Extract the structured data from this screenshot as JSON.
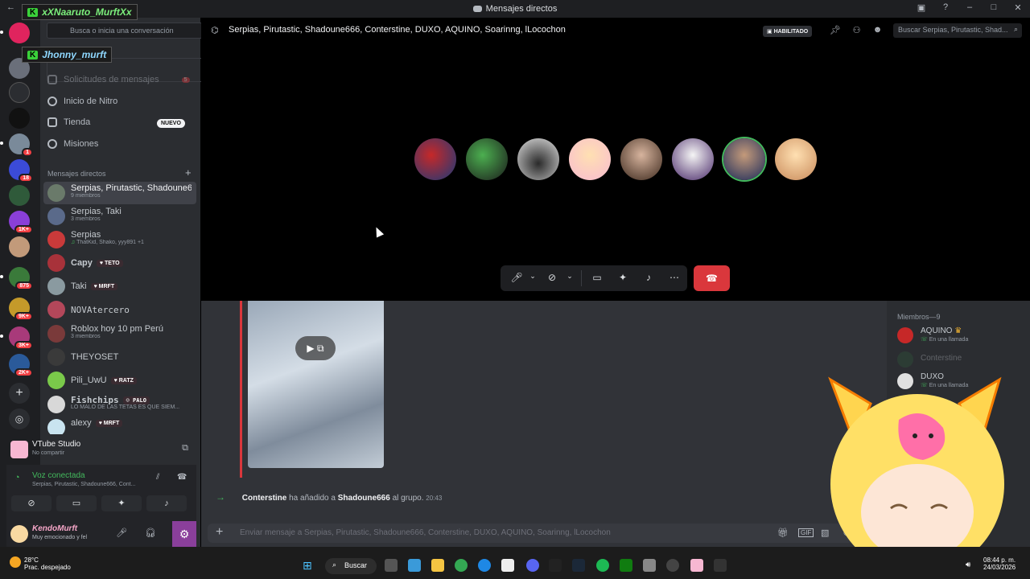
{
  "window": {
    "title": "Mensajes directos"
  },
  "overlays": {
    "name1": "xXNaaruto_MurftXx",
    "name2": "Jhonny_murft",
    "k_label": "K"
  },
  "sidebar": {
    "search_placeholder": "Busca o inicia una conversación",
    "nav": [
      {
        "label": "Solicitudes de mensajes",
        "badge": "5"
      },
      {
        "label": "Inicio de Nitro"
      },
      {
        "label": "Tienda",
        "badge": "NUEVO"
      },
      {
        "label": "Misiones"
      }
    ],
    "dm_header": "Mensajes directos",
    "dms": [
      {
        "name": "Serpias, Pirutastic, Shadoune6...",
        "sub": "9 miembros"
      },
      {
        "name": "Serpias, Taki",
        "sub": "3 miembros"
      },
      {
        "name": "Serpias",
        "sub": "ThatKid, Shako, yyy891 +1"
      },
      {
        "name": "Capy",
        "tag": "TETO"
      },
      {
        "name": "Taki",
        "tag": "MRFT"
      },
      {
        "name": "NOVAtercero"
      },
      {
        "name": "Roblox hoy 10 pm Perú",
        "sub": "3 miembros"
      },
      {
        "name": "THEYOSET"
      },
      {
        "name": "Pili_UwU",
        "tag": "RATZ"
      },
      {
        "name": "Fishchips",
        "tag": "PALO",
        "sub": "LO MALO DE LAS TETAS ES QUE SIEM..."
      },
      {
        "name": "alexy",
        "tag": "MRFT"
      }
    ],
    "server_badges": [
      "1",
      "18",
      "1K+",
      "875",
      "9K+",
      "3K+",
      "2K+"
    ]
  },
  "stream": {
    "app": "VTube Studio",
    "status": "No compartir"
  },
  "voice": {
    "status": "Voz conectada",
    "channel": "Serpias, Pirutastic, Shadoune666, Cont..."
  },
  "user": {
    "name": "KendoMurft",
    "status": "Muy emocionado y fel"
  },
  "header": {
    "group_name": "Serpias, Pirutastic, Shadoune666, Conterstine, DUXO, AQUINO, Soarinng, lLocochon",
    "badge": "HABILITADO",
    "search_placeholder": "Buscar Serpias, Pirutastic, Shad..."
  },
  "chat": {
    "system_actor": "Conterstine",
    "system_action": "ha añadido a",
    "system_target": "Shadoune666",
    "system_suffix": "al grupo.",
    "system_time": "20:43",
    "input_placeholder": "Enviar mensaje a Serpias, Pirutastic, Shadoune666, Conterstine, DUXO, AQUINO, Soarinng, lLocochon"
  },
  "members": {
    "header": "Miembros—9",
    "list": [
      {
        "name": "AQUINO",
        "status": "En una llamada"
      },
      {
        "name": "Conterstine",
        "status": ""
      },
      {
        "name": "DUXO",
        "status": "En una llamada"
      }
    ]
  },
  "taskbar": {
    "temp": "28°C",
    "weather": "Prac. despejado",
    "search": "Buscar",
    "time": "08:44 p. m.",
    "date": "24/03/2026"
  },
  "colors": {
    "accent": "#5865f2",
    "danger": "#da373c",
    "online": "#43b95d"
  }
}
